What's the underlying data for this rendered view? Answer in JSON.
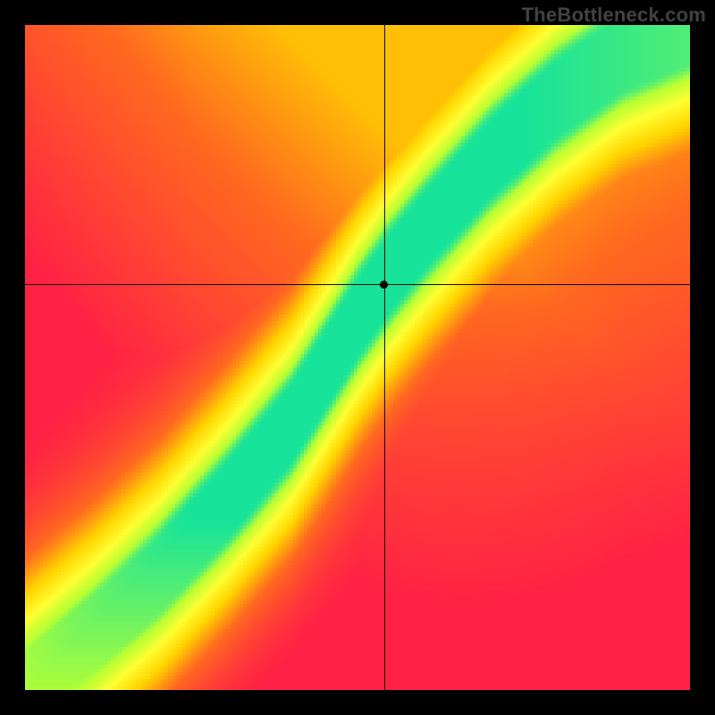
{
  "watermark": "TheBottleneck.com",
  "chart_data": {
    "type": "heatmap",
    "title": "",
    "xlabel": "",
    "ylabel": "",
    "x_range": [
      0,
      1
    ],
    "y_range": [
      0,
      1
    ],
    "grid": false,
    "crosshair": {
      "x": 0.54,
      "y": 0.61
    },
    "marker": {
      "x": 0.54,
      "y": 0.61
    },
    "ridge_curve_points": [
      {
        "x": 0.0,
        "y": 0.0
      },
      {
        "x": 0.1,
        "y": 0.08
      },
      {
        "x": 0.2,
        "y": 0.17
      },
      {
        "x": 0.3,
        "y": 0.28
      },
      {
        "x": 0.4,
        "y": 0.4
      },
      {
        "x": 0.45,
        "y": 0.48
      },
      {
        "x": 0.5,
        "y": 0.56
      },
      {
        "x": 0.55,
        "y": 0.63
      },
      {
        "x": 0.6,
        "y": 0.69
      },
      {
        "x": 0.7,
        "y": 0.8
      },
      {
        "x": 0.8,
        "y": 0.89
      },
      {
        "x": 0.9,
        "y": 0.96
      },
      {
        "x": 1.0,
        "y": 1.0
      }
    ],
    "ridge_halfwidth": 0.055,
    "colorscale": [
      {
        "t": 0.0,
        "color": "#ff2244"
      },
      {
        "t": 0.35,
        "color": "#ff6a1f"
      },
      {
        "t": 0.6,
        "color": "#ffd400"
      },
      {
        "t": 0.8,
        "color": "#ffff33"
      },
      {
        "t": 0.93,
        "color": "#b8ff33"
      },
      {
        "t": 1.0,
        "color": "#17e39a"
      }
    ],
    "corners_value_hint": {
      "top_left": 0.0,
      "top_right": 0.45,
      "bottom_left": 0.0,
      "bottom_right": 0.0,
      "along_ridge": 1.0
    }
  }
}
